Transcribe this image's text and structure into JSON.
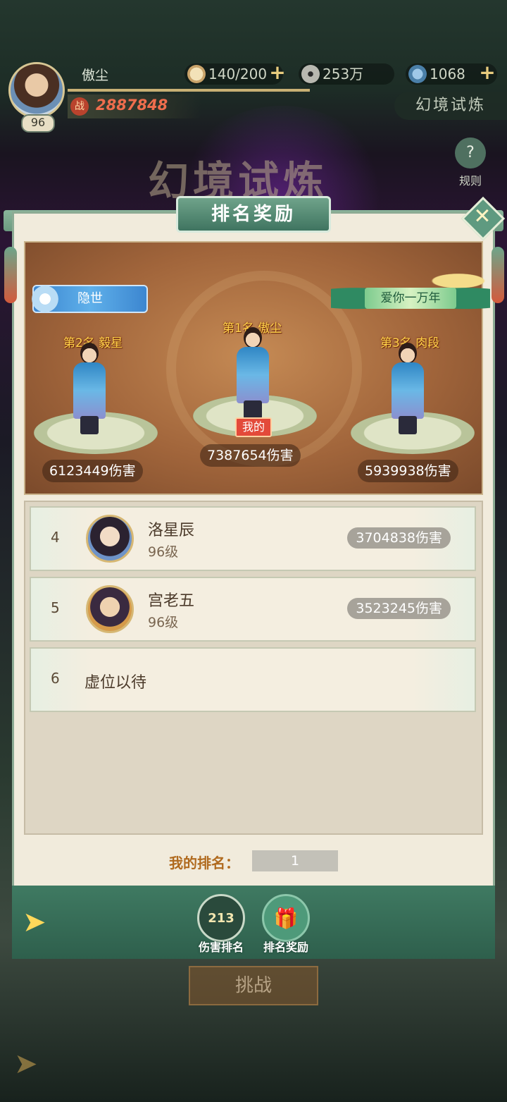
{
  "header": {
    "player_name": "傲尘",
    "level": "96",
    "power": "2887848",
    "power_icon": "战",
    "stamina": "140/200",
    "coins": "253万",
    "gems": "1068",
    "stage_tag": "幻境试炼"
  },
  "background_title": "幻境试炼",
  "rules_label": "规则",
  "panel": {
    "title": "排名奖励",
    "close_icon": "close-icon"
  },
  "podium": {
    "title_badge_left": "隐世",
    "title_badge_right": "爱你一万年",
    "first": {
      "label": "第1名 傲尘",
      "damage": "7387654伤害",
      "mine": "我的"
    },
    "second": {
      "label": "第2名 毅星",
      "damage": "6123449伤害"
    },
    "third": {
      "label": "第3名 肉段",
      "damage": "5939938伤害"
    }
  },
  "list": [
    {
      "rank": "4",
      "name": "洛星辰",
      "level": "96级",
      "damage": "3704838伤害"
    },
    {
      "rank": "5",
      "name": "宫老五",
      "level": "96级",
      "damage": "3523245伤害"
    },
    {
      "rank": "6",
      "vacant": "虚位以待"
    }
  ],
  "my_rank": {
    "label": "我的排名：",
    "value": "1"
  },
  "tabs": [
    {
      "label": "伤害排名",
      "icon": "podium-icon",
      "icon_text": "213"
    },
    {
      "label": "排名奖励",
      "icon": "gift-icon"
    }
  ],
  "challenge_label": "挑战",
  "colors": {
    "accent_green": "#3f7a62",
    "gold": "#ffd24a",
    "panel": "#f1ebdc"
  }
}
